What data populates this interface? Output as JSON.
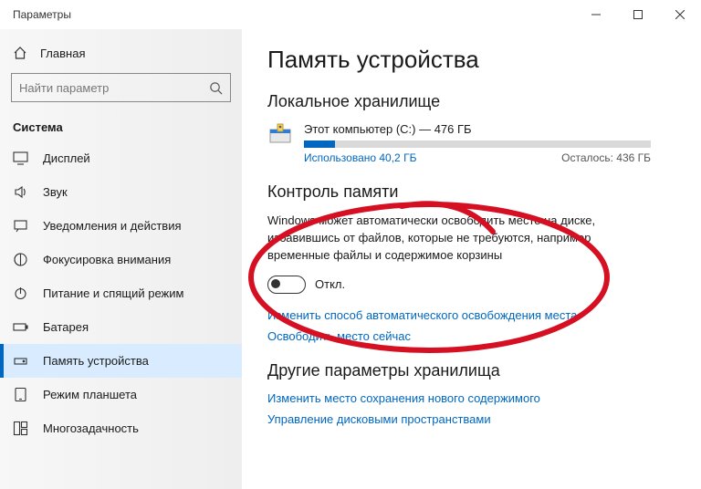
{
  "titlebar": {
    "title": "Параметры"
  },
  "home": {
    "label": "Главная"
  },
  "search": {
    "placeholder": "Найти параметр"
  },
  "section": "Система",
  "nav": [
    {
      "label": "Дисплей"
    },
    {
      "label": "Звук"
    },
    {
      "label": "Уведомления и действия"
    },
    {
      "label": "Фокусировка внимания"
    },
    {
      "label": "Питание и спящий режим"
    },
    {
      "label": "Батарея"
    },
    {
      "label": "Память устройства"
    },
    {
      "label": "Режим планшета"
    },
    {
      "label": "Многозадачность"
    }
  ],
  "page": {
    "title": "Память устройства",
    "local_heading": "Локальное хранилище",
    "disk": {
      "label": "Этот компьютер (C:) — 476 ГБ",
      "used": "Использовано 40,2 ГБ",
      "free": "Осталось: 436 ГБ"
    },
    "storage_sense": {
      "heading": "Контроль памяти",
      "desc": "Windows может автоматически освободить место на диске, избавившись от файлов, которые не требуются, например временные файлы и содержимое корзины",
      "state": "Откл.",
      "link_change": "Изменить способ автоматического освобождения места",
      "link_free": "Освободить место сейчас"
    },
    "other": {
      "heading": "Другие параметры хранилища",
      "link_change_loc": "Изменить место сохранения нового содержимого",
      "link_spaces": "Управление дисковыми пространствами"
    }
  }
}
